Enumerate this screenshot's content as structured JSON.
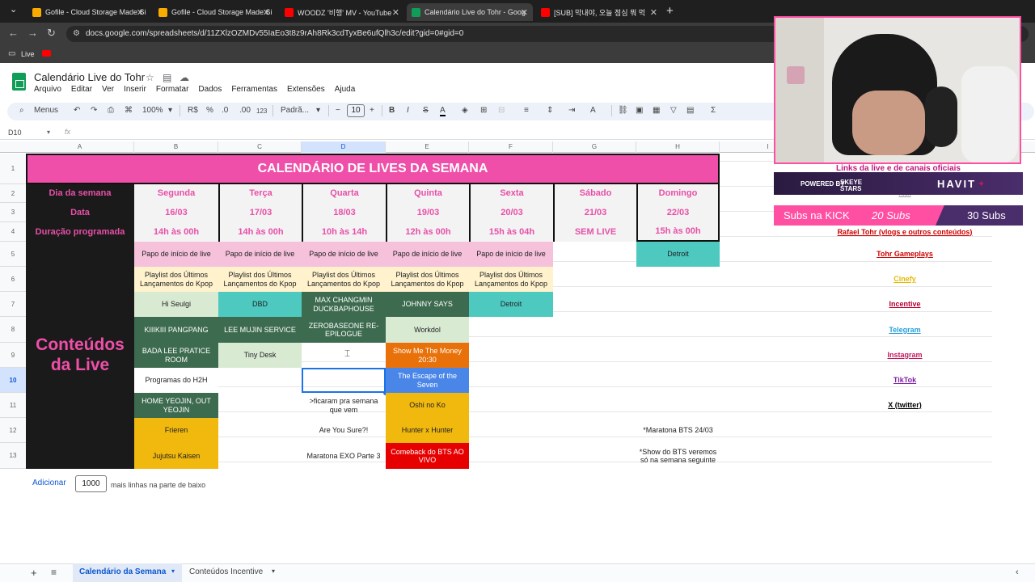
{
  "browser": {
    "tabs": [
      {
        "title": "Gofile - Cloud Storage Made Si",
        "color": "#f9ab00"
      },
      {
        "title": "Gofile - Cloud Storage Made Si",
        "color": "#f9ab00"
      },
      {
        "title": "WOODZ '비행' MV - YouTube",
        "color": "#ff0000"
      },
      {
        "title": "Calendário Live do Tohr - Goog",
        "color": "#0f9d58"
      },
      {
        "title": "[SUB] 막내야, 오늘 점심 뭐 먹",
        "color": "#ff0000"
      }
    ],
    "url": "docs.google.com/spreadsheets/d/11ZXlzOZMDv55IaEo3t8z9rAh8Rk3cdTyxBe6ufQlh3c/edit?gid=0#gid=0",
    "bookmark": "Live"
  },
  "doc": {
    "title": "Calendário Live do Tohr",
    "menus": [
      "Arquivo",
      "Editar",
      "Ver",
      "Inserir",
      "Formatar",
      "Dados",
      "Ferramentas",
      "Extensões",
      "Ajuda"
    ]
  },
  "toolbar": {
    "menus": "Menus",
    "zoom": "100%",
    "currency": "R$",
    "percent": "%",
    "dec_minus": ".0",
    "dec_plus": ".00",
    "num": "123",
    "font": "Padrã...",
    "size": "10"
  },
  "namebox": "D10",
  "fx": "fx",
  "columns": [
    "A",
    "B",
    "C",
    "D",
    "E",
    "F",
    "G",
    "H",
    "I"
  ],
  "rows": [
    "1",
    "2",
    "3",
    "4",
    "5",
    "6",
    "7",
    "8",
    "9",
    "10",
    "11",
    "12",
    "13"
  ],
  "sheet": {
    "title": "CALENDÁRIO DE LIVES DA SEMANA",
    "labels": [
      "Dia da semana",
      "Data",
      "Duração programada"
    ],
    "side": "Conteúdos da Live",
    "days": [
      {
        "day": "Segunda",
        "date": "16/03",
        "dur": "14h às 00h"
      },
      {
        "day": "Terça",
        "date": "17/03",
        "dur": "14h às 00h"
      },
      {
        "day": "Quarta",
        "date": "18/03",
        "dur": "10h às 14h"
      },
      {
        "day": "Quinta",
        "date": "19/03",
        "dur": "12h às 00h"
      },
      {
        "day": "Sexta",
        "date": "20/03",
        "dur": "15h às 04h"
      },
      {
        "day": "Sábado",
        "date": "21/03",
        "dur": "SEM LIVE"
      },
      {
        "day": "Domingo",
        "date": "22/03",
        "dur": "15h às 00h"
      }
    ],
    "papo": "Papo de início de live",
    "playlist": "Playlist dos Últimos Lançamentos do Kpop",
    "seg": [
      "Hi Seulgi",
      "KIIIKIII PANGPANG",
      "BADA LEE PRATICE ROOM",
      "Programas do H2H",
      "HOME YEOJIN, OUT YEOJIN",
      "Frieren",
      "Jujutsu Kaisen"
    ],
    "ter": [
      "DBD",
      "LEE MUJIN SERVICE",
      "Tiny Desk"
    ],
    "qua": [
      "MAX CHANGMIN DUCKBAPHOUSE",
      "ZEROBASEONE RE-EPILOGUE",
      ">ficaram pra semana que vem",
      "Are You Sure?!",
      "Maratona EXO Parte 3"
    ],
    "qui": [
      "JOHNNY SAYS",
      "Workdol",
      "Show Me The Money 20:30",
      "The Escape of the Seven",
      "Oshi no Ko",
      "Hunter x Hunter",
      "Comeback do BTS AO VIVO"
    ],
    "sex": [
      "Detroit"
    ],
    "dom": [
      "Detroit"
    ],
    "notes": [
      "*Maratona BTS 24/03",
      "*Show do BTS veremos só na semana seguinte"
    ],
    "links_title": "Links da live e de canais oficiais",
    "links": [
      {
        "text": "Rafael Tohr (vlogs e outros conteúdos)",
        "color": "#cc0000"
      },
      {
        "text": "Tohr Gameplays",
        "color": "#cc0000"
      },
      {
        "text": "Cinefy",
        "color": "#e6b800"
      },
      {
        "text": "Incentive",
        "color": "#b4002f"
      },
      {
        "text": "Telegram",
        "color": "#2aa0d8"
      },
      {
        "text": "Instagram",
        "color": "#c2185b"
      },
      {
        "text": "TikTok",
        "color": "#7b1fa2"
      },
      {
        "text": "X (twitter)",
        "color": "#000000"
      }
    ],
    "kick_hint": "Kick"
  },
  "overlay": {
    "sponsor_left": "POWERED BY",
    "sponsor_mid": "SKEYE STARS",
    "sponsor_right": "HAVIT",
    "kick_label": "Subs na KICK",
    "kick_a": "20 Subs",
    "kick_b": "30 Subs"
  },
  "bottom": {
    "add": "Adicionar",
    "rows": "1000",
    "rows_text": "mais linhas na parte de baixo"
  },
  "sheettabs": [
    "Calendário da Semana",
    "Conteúdos Incentive"
  ]
}
